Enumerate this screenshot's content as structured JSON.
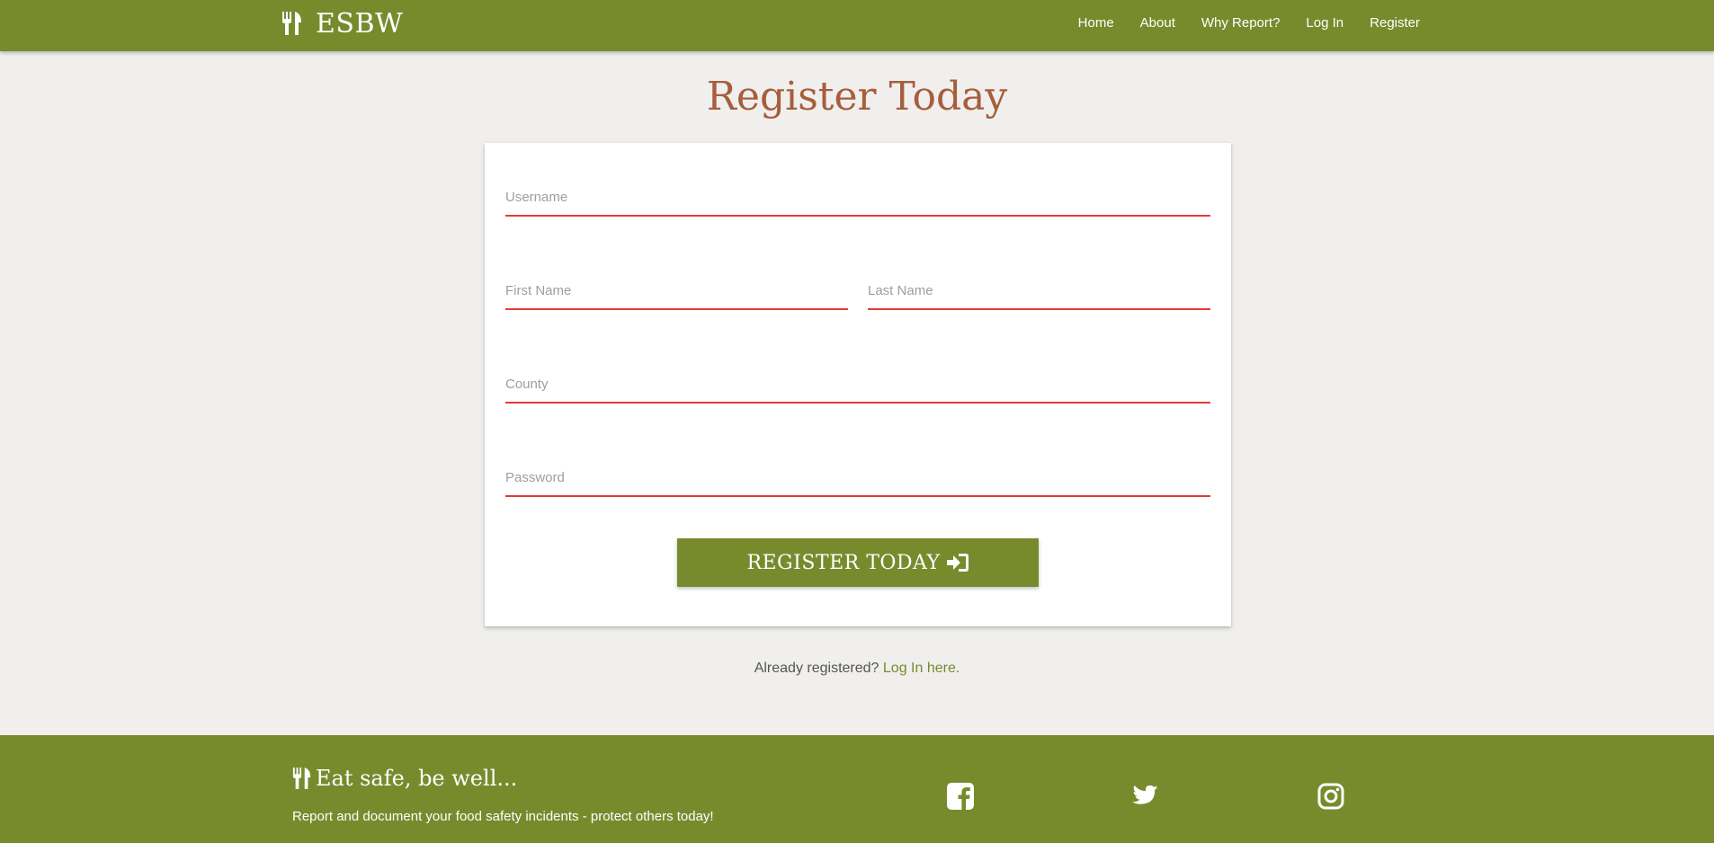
{
  "navbar": {
    "brand": "ESBW",
    "links": [
      "Home",
      "About",
      "Why Report?",
      "Log In",
      "Register"
    ]
  },
  "page": {
    "title": "Register Today"
  },
  "form": {
    "username_placeholder": "Username",
    "first_name_placeholder": "First Name",
    "last_name_placeholder": "Last Name",
    "county_placeholder": "County",
    "password_placeholder": "Password",
    "submit_label": "REGISTER TODAY"
  },
  "login_prompt": {
    "text": "Already registered?",
    "link": "Log In here."
  },
  "footer": {
    "brand": "Eat safe, be well...",
    "tagline": "Report and document your food safety incidents - protect others today!",
    "social": [
      "facebook-icon",
      "twitter-icon",
      "instagram-icon"
    ]
  },
  "colors": {
    "primary": "#778b2d",
    "title": "#a65e3c",
    "field_underline": "#e53935",
    "background": "#f0efed"
  }
}
